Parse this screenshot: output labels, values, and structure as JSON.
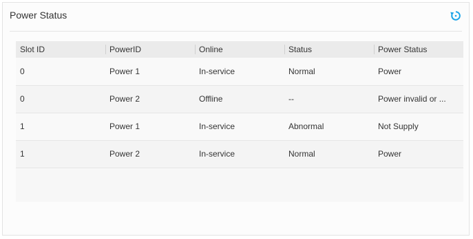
{
  "panel": {
    "title": "Power Status",
    "refresh_icon": "refresh-icon",
    "accent_color": "#1aa3e8"
  },
  "table": {
    "headers": [
      "Slot ID",
      "PowerID",
      "Online",
      "Status",
      "Power Status"
    ],
    "rows": [
      [
        "0",
        "Power 1",
        "In-service",
        "Normal",
        "Power"
      ],
      [
        "0",
        "Power 2",
        "Offline",
        "--",
        "Power invalid or ..."
      ],
      [
        "1",
        "Power 1",
        "In-service",
        "Abnormal",
        "Not Supply"
      ],
      [
        "1",
        "Power 2",
        "In-service",
        "Normal",
        "Power"
      ]
    ]
  }
}
